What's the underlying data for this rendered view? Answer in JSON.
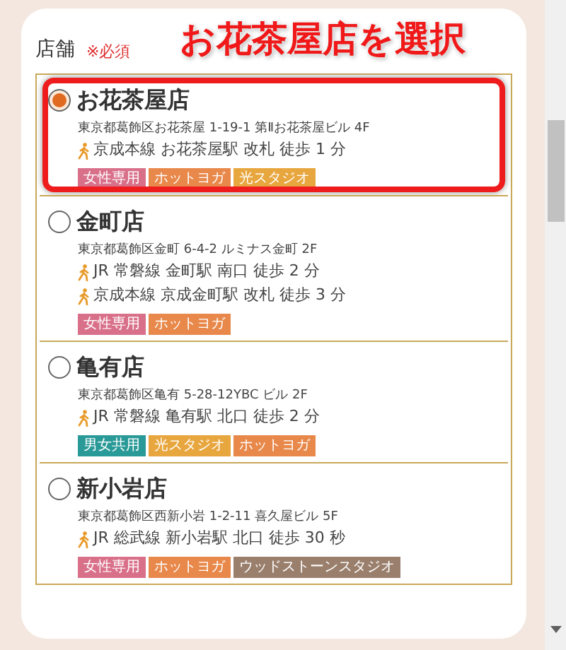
{
  "field": {
    "label": "店舗",
    "required": "※必須"
  },
  "annotation": {
    "text": "お花茶屋店を選択"
  },
  "stores": [
    {
      "name": "お花茶屋店",
      "selected": true,
      "highlighted": true,
      "address": "東京都葛飾区お花茶屋 1-19-1 第Ⅱお花茶屋ビル 4F",
      "access": [
        "京成本線 お花茶屋駅 改札 徒歩 1 分"
      ],
      "tags": [
        {
          "label": "女性専用",
          "color": "#d9708a"
        },
        {
          "label": "ホットヨガ",
          "color": "#e8884a"
        },
        {
          "label": "光スタジオ",
          "color": "#e8a63e"
        }
      ]
    },
    {
      "name": "金町店",
      "selected": false,
      "highlighted": false,
      "address": "東京都葛飾区金町 6-4-2 ルミナス金町 2F",
      "access": [
        "JR 常磐線 金町駅 南口 徒歩 2 分",
        "京成本線 京成金町駅 改札 徒歩 3 分"
      ],
      "tags": [
        {
          "label": "女性専用",
          "color": "#d9708a"
        },
        {
          "label": "ホットヨガ",
          "color": "#e8884a"
        }
      ]
    },
    {
      "name": "亀有店",
      "selected": false,
      "highlighted": false,
      "address": "東京都葛飾区亀有 5-28-12YBC ビル 2F",
      "access": [
        "JR 常磐線 亀有駅 北口 徒歩 2 分"
      ],
      "tags": [
        {
          "label": "男女共用",
          "color": "#2a9a98"
        },
        {
          "label": "光スタジオ",
          "color": "#e8a63e"
        },
        {
          "label": "ホットヨガ",
          "color": "#e8884a"
        }
      ]
    },
    {
      "name": "新小岩店",
      "selected": false,
      "highlighted": false,
      "address": "東京都葛飾区西新小岩 1-2-11 喜久屋ビル 5F",
      "access": [
        "JR 総武線 新小岩駅 北口 徒歩 30 秒"
      ],
      "tags": [
        {
          "label": "女性専用",
          "color": "#d9708a"
        },
        {
          "label": "ホットヨガ",
          "color": "#e8884a"
        },
        {
          "label": "ウッドストーンスタジオ",
          "color": "#9a7f6c"
        }
      ]
    }
  ]
}
